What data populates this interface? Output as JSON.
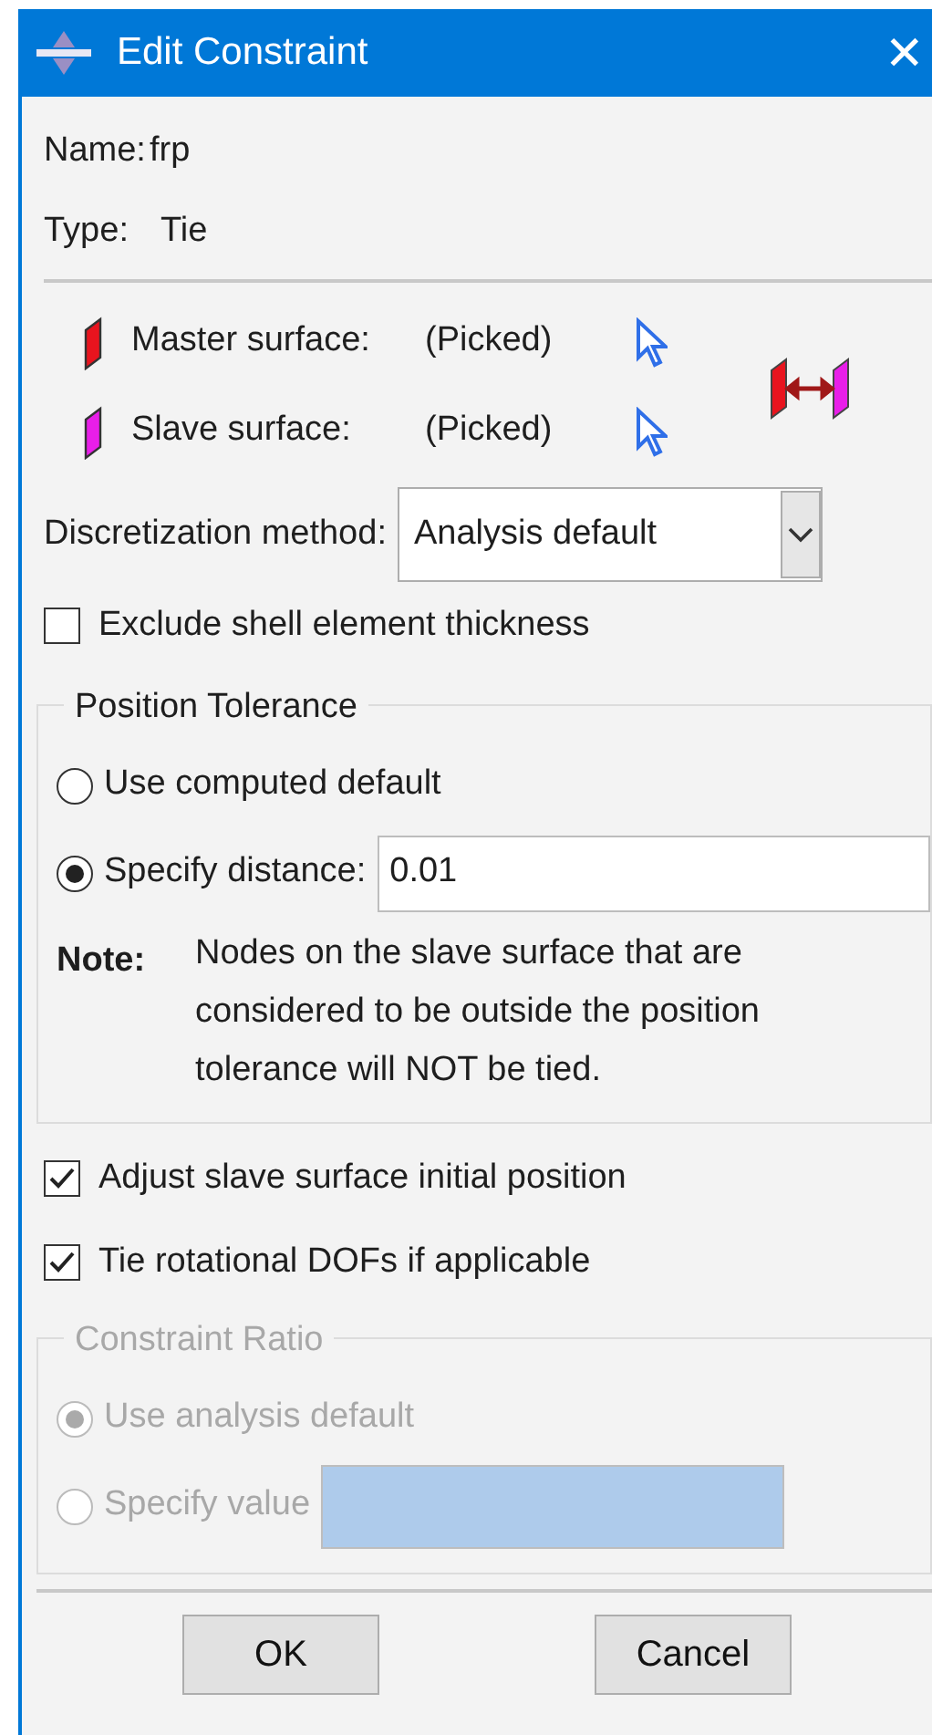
{
  "window": {
    "title": "Edit Constraint",
    "close_glyph": "✕"
  },
  "name": {
    "label": "Name:",
    "value": "frp"
  },
  "type": {
    "label": "Type:",
    "value": "Tie"
  },
  "surfaces": [
    {
      "label": "Master surface:",
      "value": "(Picked)",
      "color": "#e8141e"
    },
    {
      "label": "Slave surface:",
      "value": "(Picked)",
      "color": "#e81ee8"
    }
  ],
  "discretization": {
    "label": "Discretization method:",
    "value": "Analysis default"
  },
  "exclude_shell_thickness": {
    "label": "Exclude shell element thickness",
    "checked": false
  },
  "position_tolerance": {
    "title": "Position Tolerance",
    "options": [
      {
        "label": "Use computed default",
        "selected": false
      },
      {
        "label": "Specify distance:",
        "selected": true,
        "value": "0.01"
      }
    ],
    "note": {
      "label": "Note:",
      "text": "Nodes on the slave surface that are considered to be outside the position tolerance will NOT be tied."
    }
  },
  "checkboxes": [
    {
      "label": "Adjust slave surface initial position",
      "checked": true
    },
    {
      "label": "Tie rotational DOFs if applicable",
      "checked": true
    }
  ],
  "constraint_ratio": {
    "title": "Constraint Ratio",
    "disabled": true,
    "options": [
      {
        "kind": "radio",
        "label": "Use analysis default",
        "selected": true
      },
      {
        "kind": "radio_field",
        "label": "Specify value",
        "selected": false
      }
    ]
  },
  "buttons": [
    "OK",
    "Cancel"
  ]
}
